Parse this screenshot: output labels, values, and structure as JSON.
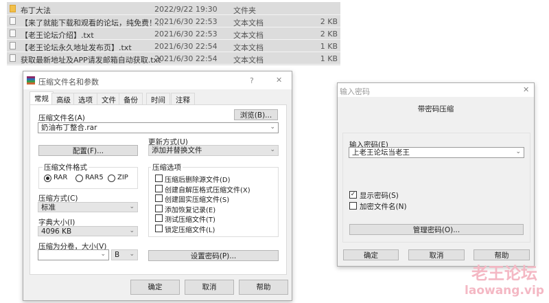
{
  "files": [
    {
      "name": "布丁大法",
      "date": "2022/9/22 19:30",
      "type": "文件夹",
      "size": "",
      "icon": "folder-icon"
    },
    {
      "name": "【来了就能下载和观看的论坛，纯免费！...",
      "date": "2021/6/30 22:53",
      "type": "文本文档",
      "size": "2 KB",
      "icon": "text-file-icon"
    },
    {
      "name": "【老王论坛介绍】.txt",
      "date": "2021/6/30 22:53",
      "type": "文本文档",
      "size": "2 KB",
      "icon": "text-file-icon"
    },
    {
      "name": "【老王论坛永久地址发布页】.txt",
      "date": "2021/6/30 22:54",
      "type": "文本文档",
      "size": "1 KB",
      "icon": "text-file-icon"
    },
    {
      "name": "获取最新地址及APP请发邮箱自动获取.txt",
      "date": "2021/6/30 22:54",
      "type": "文本文档",
      "size": "1 KB",
      "icon": "text-file-icon"
    }
  ],
  "archive_dialog": {
    "title": "压缩文件名和参数",
    "help": "?",
    "close": "✕",
    "tabs": [
      "常规",
      "高级",
      "选项",
      "文件",
      "备份",
      "时间",
      "注释"
    ],
    "archive_name_label": "压缩文件名(A)",
    "browse": "浏览(B)...",
    "archive_name": "奶油布丁整合.rar",
    "update_label": "更新方式(U)",
    "update_value": "添加并替换文件",
    "profiles": "配置(F)...",
    "format_label": "压缩文件格式",
    "formats": [
      "RAR",
      "RAR5",
      "ZIP"
    ],
    "format_selected": "RAR",
    "options_label": "压缩选项",
    "options": [
      {
        "label": "压缩后删除源文件(D)",
        "checked": false
      },
      {
        "label": "创建自解压格式压缩文件(X)",
        "checked": false
      },
      {
        "label": "创建固实压缩文件(S)",
        "checked": false
      },
      {
        "label": "添加恢复记录(E)",
        "checked": false
      },
      {
        "label": "测试压缩文件(T)",
        "checked": false
      },
      {
        "label": "锁定压缩文件(L)",
        "checked": false
      }
    ],
    "method_label": "压缩方式(C)",
    "method_value": "标准",
    "dict_label": "字典大小(I)",
    "dict_value": "4096 KB",
    "split_label": "压缩为分卷，大小(V)",
    "split_value": "",
    "split_unit": "B",
    "set_password": "设置密码(P)...",
    "ok": "确定",
    "cancel": "取消",
    "help_btn": "帮助"
  },
  "password_dialog": {
    "title": "输入密码",
    "close": "✕",
    "heading": "带密码压缩",
    "password_label": "输入密码(E)",
    "password_value": "上老王论坛当老王",
    "show_password": "显示密码(S)",
    "show_password_checked": true,
    "encrypt_names": "加密文件名(N)",
    "encrypt_names_checked": false,
    "organize": "管理密码(O)...",
    "ok": "确定",
    "cancel": "取消",
    "help_btn": "帮助"
  },
  "watermark": {
    "text": "老王论坛",
    "url": "laowang.vip",
    "color": "#f4b8c4"
  }
}
